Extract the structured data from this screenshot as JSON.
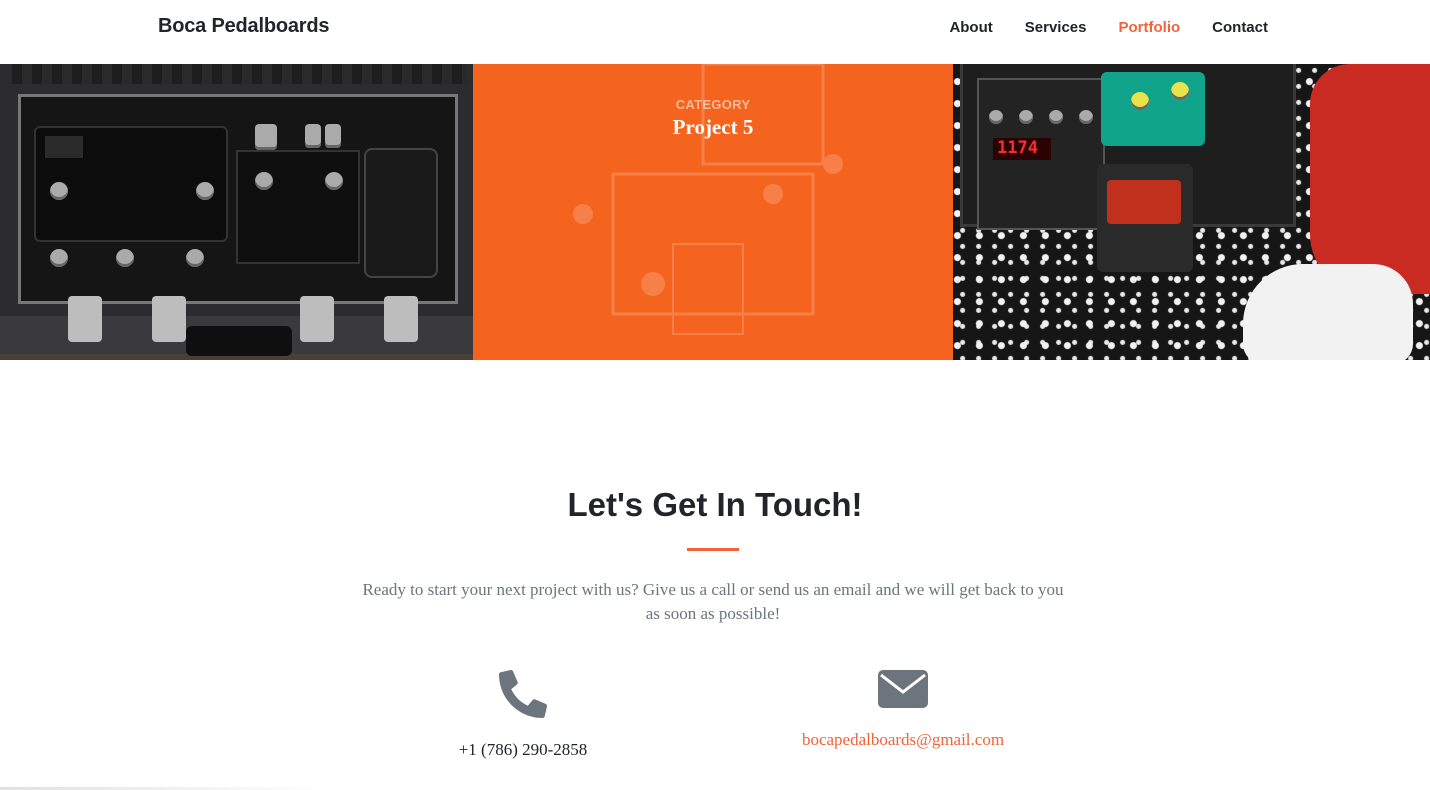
{
  "navbar": {
    "brand": "Boca Pedalboards",
    "links": [
      {
        "label": "About",
        "active": false
      },
      {
        "label": "Services",
        "active": false
      },
      {
        "label": "Portfolio",
        "active": true
      },
      {
        "label": "Contact",
        "active": false
      }
    ]
  },
  "portfolio": {
    "hover_tile": {
      "category": "CATEGORY",
      "project": "Project 5"
    },
    "delay_readout": "1174"
  },
  "contact": {
    "title": "Let's Get In Touch!",
    "text": "Ready to start your next project with us? Give us a call or send us an email and we will get back to you as soon as possible!",
    "phone": "+1 (786) 290-2858",
    "email": "bocapedalboards@gmail.com",
    "phone_icon": "phone-icon",
    "email_icon": "envelope-icon"
  },
  "colors": {
    "accent": "#f4623a",
    "hover_overlay": "#f4641e",
    "muted_text": "#6c757d",
    "icon_gray": "#6c757d"
  }
}
